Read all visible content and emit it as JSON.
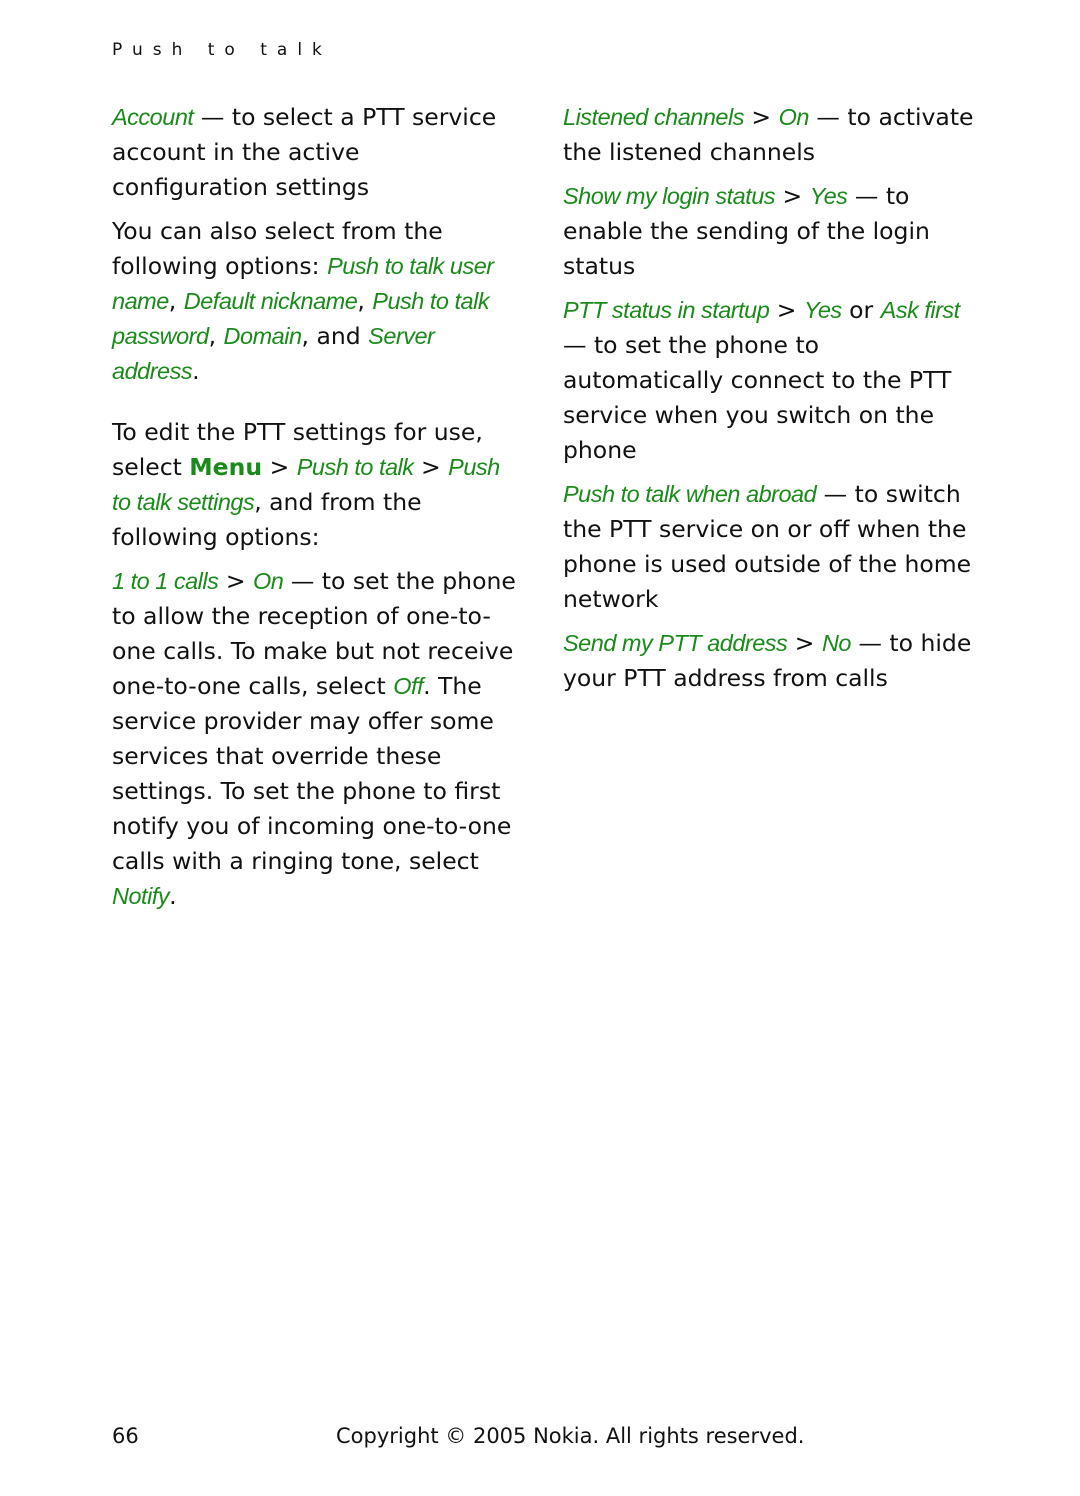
{
  "header": {
    "section_title": "Push to talk"
  },
  "left_column": {
    "account": {
      "term": "Account",
      "desc": " — to select a PTT service account in the active configuration settings"
    },
    "also_select": {
      "intro": "You can also select from the following options: ",
      "opt1": "Push to talk user name",
      "sep1": ", ",
      "opt2": "Default nickname",
      "sep2": ", ",
      "opt3": "Push to talk password",
      "sep3": ", ",
      "opt4": "Domain",
      "sep4": ", and ",
      "opt5": "Server address",
      "end": "."
    },
    "edit_settings": {
      "intro": "To edit the PTT settings for use, select ",
      "menu": "Menu",
      "gt1": " > ",
      "path1": "Push to talk",
      "gt2": " > ",
      "path2": "Push to talk settings",
      "outro": ", and from the following options:"
    },
    "one_to_one": {
      "term": "1 to 1 calls",
      "gt": " > ",
      "value": "On",
      "desc1": " — to set the phone to allow the reception of one-to-one calls. To make but not receive one-to-one calls, select ",
      "off": "Off",
      "desc2": ". The service provider may offer some services that override these settings. To set the phone to first notify you of incoming one-to-one calls with a ringing tone, select ",
      "notify": "Notify",
      "end": "."
    }
  },
  "right_column": {
    "listened": {
      "term": "Listened channels",
      "gt": " > ",
      "value": "On",
      "desc": " — to activate the listened channels"
    },
    "login_status": {
      "term": "Show my login status",
      "gt": " > ",
      "value": "Yes",
      "desc": " — to enable the sending of the login status"
    },
    "startup": {
      "term": "PTT status in startup",
      "gt": " > ",
      "value1": "Yes",
      "or": " or ",
      "value2": "Ask first",
      "desc": " — to set the phone to automatically connect to the PTT service when you switch on the phone"
    },
    "abroad": {
      "term": "Push to talk when abroad",
      "desc": " — to switch the PTT service on or off when the phone is used outside of the home network"
    },
    "send_address": {
      "term": "Send my PTT address",
      "gt": " > ",
      "value": "No",
      "desc": " — to hide your PTT address from calls"
    }
  },
  "footer": {
    "page_number": "66",
    "copyright": "Copyright © 2005 Nokia. All rights reserved."
  },
  "colors": {
    "accent_green": "#1a8a1a",
    "text": "#111111"
  }
}
